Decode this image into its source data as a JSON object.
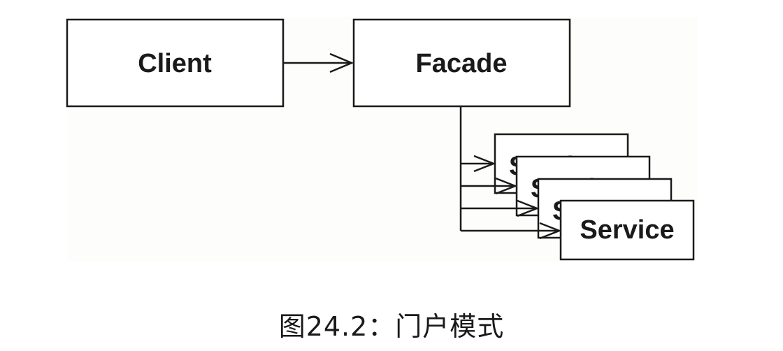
{
  "diagram": {
    "client_label": "Client",
    "facade_label": "Facade",
    "service_label": "Service"
  },
  "caption": "图24.2：门户模式",
  "colors": {
    "stroke": "#1a1a1a",
    "panel": "#fdfdfb",
    "background": "#ffffff"
  }
}
